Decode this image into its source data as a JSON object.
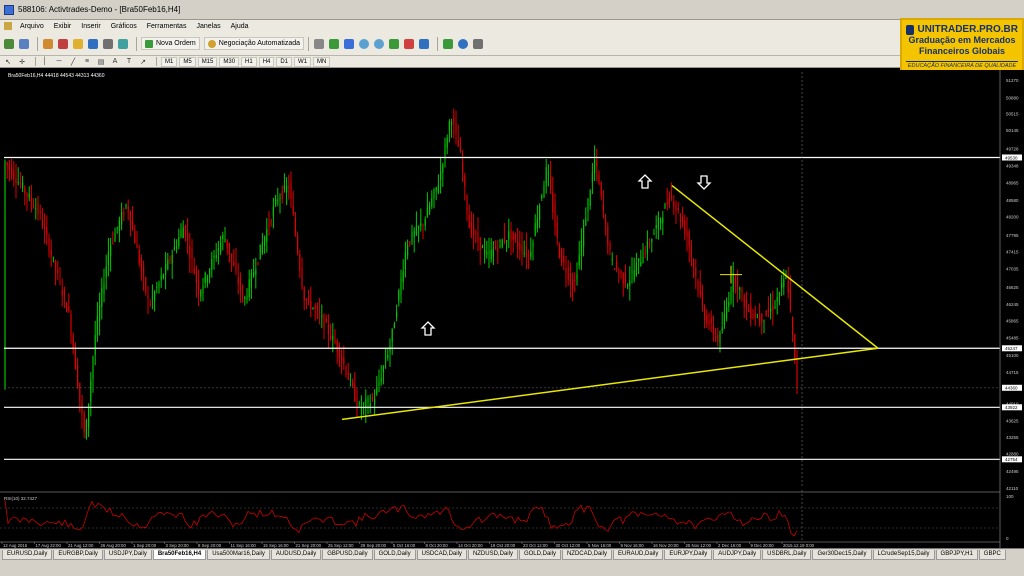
{
  "window": {
    "title": "588106: Activtrades-Demo - [Bra50Feb16,H4]"
  },
  "menu": [
    "Arquivo",
    "Exibir",
    "Inserir",
    "Gráficos",
    "Ferramentas",
    "Janelas",
    "Ajuda"
  ],
  "toolbar": {
    "new_order": "Nova Ordem",
    "auto_trading": "Negociação Automatizada"
  },
  "timeframes": [
    "M1",
    "M5",
    "M15",
    "M30",
    "H1",
    "H4",
    "D1",
    "W1",
    "MN"
  ],
  "drawing_tools": [
    "A",
    "T"
  ],
  "logo": {
    "brand": "UNITRADER.PRO.BR",
    "line1": "Graduação em Mercados",
    "line2": "Financeiros Globais",
    "tagline": "EDUCAÇÃO FINANCEIRA DE QUALIDADE"
  },
  "chart": {
    "header": "Bra50Feb16,H4  44418 44543 44313 44360",
    "indicator_label": "RSI(10) 32.7427",
    "price_scale": [
      "51270",
      "50880",
      "50515",
      "50145",
      "49728",
      "49348",
      "48965",
      "48580",
      "48200",
      "47795",
      "47415",
      "47035",
      "46625",
      "46245",
      "45865",
      "45485",
      "45100",
      "44715",
      "44010",
      "43625",
      "43255",
      "42880",
      "42495",
      "42110"
    ],
    "highlighted_prices": {
      "upper": "49530",
      "middle": "45247",
      "current": "44360",
      "lower": "43922",
      "bottom": "42754"
    },
    "date_labels": [
      "12 Aug 2015",
      "17 Aug 22:00",
      "21 Aug 12:00",
      "26 Aug 20:00",
      "1 Sep 20:00",
      "3 Sep 20:00",
      "8 Sep 20:00",
      "11 Sep 16:00",
      "15 Sep 16:00",
      "21 Sep 20:00",
      "25 Sep 12:00",
      "29 Sep 20:00",
      "5 Oct 16:00",
      "8 Oct 20:00",
      "14 Oct 20:00",
      "19 Oct 20:00",
      "23 Oct 12:00",
      "30 Oct 12:00",
      "5 Nov 16:00",
      "9 Nov 16:00",
      "16 Nov 20:00",
      "25 Nov 12:00",
      "2 Dec 16:00",
      "9 Dec 20:00",
      "2015.12.19 0:00"
    ],
    "rsi_scale": [
      "100",
      "0"
    ],
    "colors": {
      "bull": "#00c800",
      "bear": "#e00000",
      "trendline": "#e8e800",
      "level": "#ffffff",
      "grid": "#1a1a1a"
    }
  },
  "tabs": [
    {
      "label": "EURUSD,Daily",
      "active": false
    },
    {
      "label": "EURGBP,Daily",
      "active": false
    },
    {
      "label": "USDJPY,Daily",
      "active": false
    },
    {
      "label": "Bra50Feb16,H4",
      "active": true
    },
    {
      "label": "Usa500Mar16,Daily",
      "active": false
    },
    {
      "label": "AUDUSD,Daily",
      "active": false
    },
    {
      "label": "GBPUSD,Daily",
      "active": false
    },
    {
      "label": "GOLD,Daily",
      "active": false
    },
    {
      "label": "USDCAD,Daily",
      "active": false
    },
    {
      "label": "NZDUSD,Daily",
      "active": false
    },
    {
      "label": "GOLD,Daily",
      "active": false
    },
    {
      "label": "NZDCAD,Daily",
      "active": false
    },
    {
      "label": "EURAUD,Daily",
      "active": false
    },
    {
      "label": "EURJPY,Daily",
      "active": false
    },
    {
      "label": "AUDJPY,Daily",
      "active": false
    },
    {
      "label": "USDBRL,Daily",
      "active": false
    },
    {
      "label": "Ger30Dec15,Daily",
      "active": false
    },
    {
      "label": "LCrudeSep15,Daily",
      "active": false
    },
    {
      "label": "GBPJPY,H1",
      "active": false
    },
    {
      "label": "GBPC",
      "active": false
    }
  ]
}
